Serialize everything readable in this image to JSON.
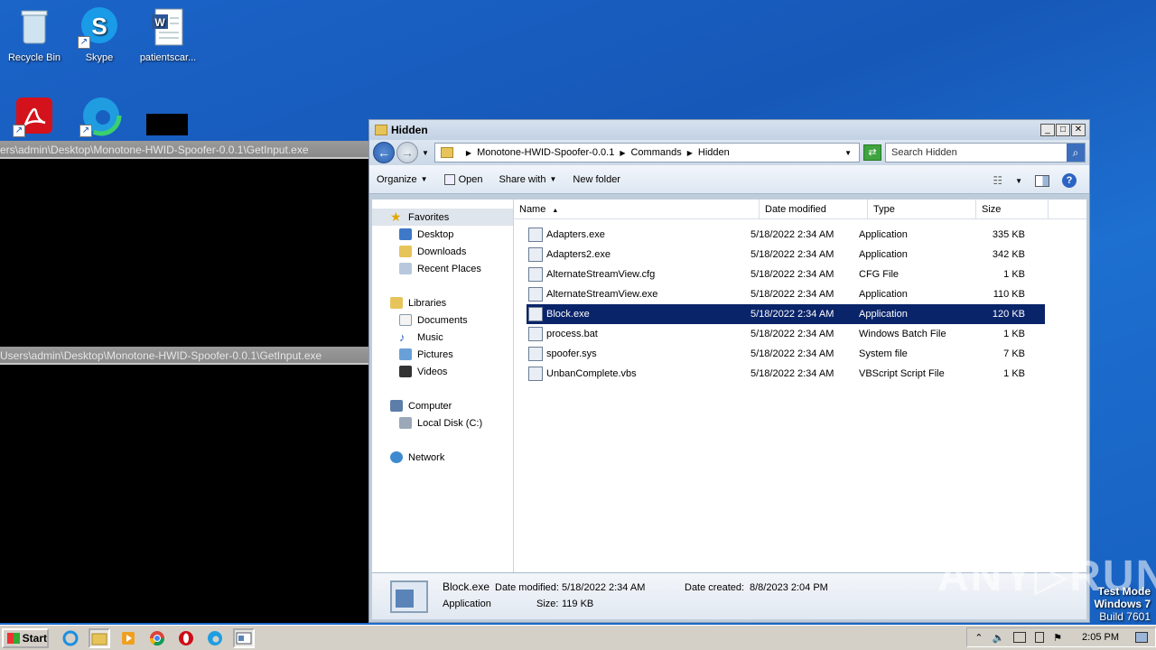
{
  "desktop": {
    "icons": [
      {
        "label": "Recycle Bin",
        "icon": "recycle-bin-icon"
      },
      {
        "label": "Skype",
        "icon": "skype-icon"
      },
      {
        "label": "patientscar...",
        "icon": "word-document-icon"
      },
      {
        "label": "",
        "icon": "acrobat-icon"
      },
      {
        "label": "",
        "icon": "edge-icon"
      }
    ]
  },
  "consoles": [
    {
      "title": "ers\\admin\\Desktop\\Monotone-HWID-Spoofer-0.0.1\\GetInput.exe"
    },
    {
      "title": "Users\\admin\\Desktop\\Monotone-HWID-Spoofer-0.0.1\\GetInput.exe"
    }
  ],
  "explorer": {
    "title": "Hidden",
    "window_buttons": {
      "minimize": "_",
      "maximize": "□",
      "close": "✕"
    },
    "nav_back": "←",
    "nav_forward": "→",
    "breadcrumb": [
      "Monotone-HWID-Spoofer-0.0.1",
      "Commands",
      "Hidden"
    ],
    "search_placeholder": "Search Hidden",
    "commands": {
      "organize": "Organize",
      "open": "Open",
      "share_with": "Share with",
      "new_folder": "New folder"
    },
    "nav": {
      "favorites": "Favorites",
      "desktop": "Desktop",
      "downloads": "Downloads",
      "recent": "Recent Places",
      "libraries": "Libraries",
      "documents": "Documents",
      "music": "Music",
      "pictures": "Pictures",
      "videos": "Videos",
      "computer": "Computer",
      "local_disk": "Local Disk (C:)",
      "network": "Network"
    },
    "columns": {
      "name": "Name",
      "date": "Date modified",
      "type": "Type",
      "size": "Size"
    },
    "files": [
      {
        "name": "Adapters.exe",
        "date": "5/18/2022 2:34 AM",
        "type": "Application",
        "size": "335 KB"
      },
      {
        "name": "Adapters2.exe",
        "date": "5/18/2022 2:34 AM",
        "type": "Application",
        "size": "342 KB"
      },
      {
        "name": "AlternateStreamView.cfg",
        "date": "5/18/2022 2:34 AM",
        "type": "CFG File",
        "size": "1 KB"
      },
      {
        "name": "AlternateStreamView.exe",
        "date": "5/18/2022 2:34 AM",
        "type": "Application",
        "size": "110 KB"
      },
      {
        "name": "Block.exe",
        "date": "5/18/2022 2:34 AM",
        "type": "Application",
        "size": "120 KB"
      },
      {
        "name": "process.bat",
        "date": "5/18/2022 2:34 AM",
        "type": "Windows Batch File",
        "size": "1 KB"
      },
      {
        "name": "spoofer.sys",
        "date": "5/18/2022 2:34 AM",
        "type": "System file",
        "size": "7 KB"
      },
      {
        "name": "UnbanComplete.vbs",
        "date": "5/18/2022 2:34 AM",
        "type": "VBScript Script File",
        "size": "1 KB"
      }
    ],
    "selected_index": 4,
    "details": {
      "name": "Block.exe",
      "type": "Application",
      "modified_label": "Date modified:",
      "modified": "5/18/2022 2:34 AM",
      "size_label": "Size:",
      "size": "119 KB",
      "created_label": "Date created:",
      "created": "8/8/2023 2:04 PM"
    }
  },
  "taskbar": {
    "start": "Start",
    "clock": "2:05 PM",
    "tray_up_arrow": "⌃"
  },
  "watermark": "ANY▷RUN",
  "testmode": {
    "line1": "Test Mode",
    "line2": "Windows 7",
    "line3": "Build 7601"
  }
}
